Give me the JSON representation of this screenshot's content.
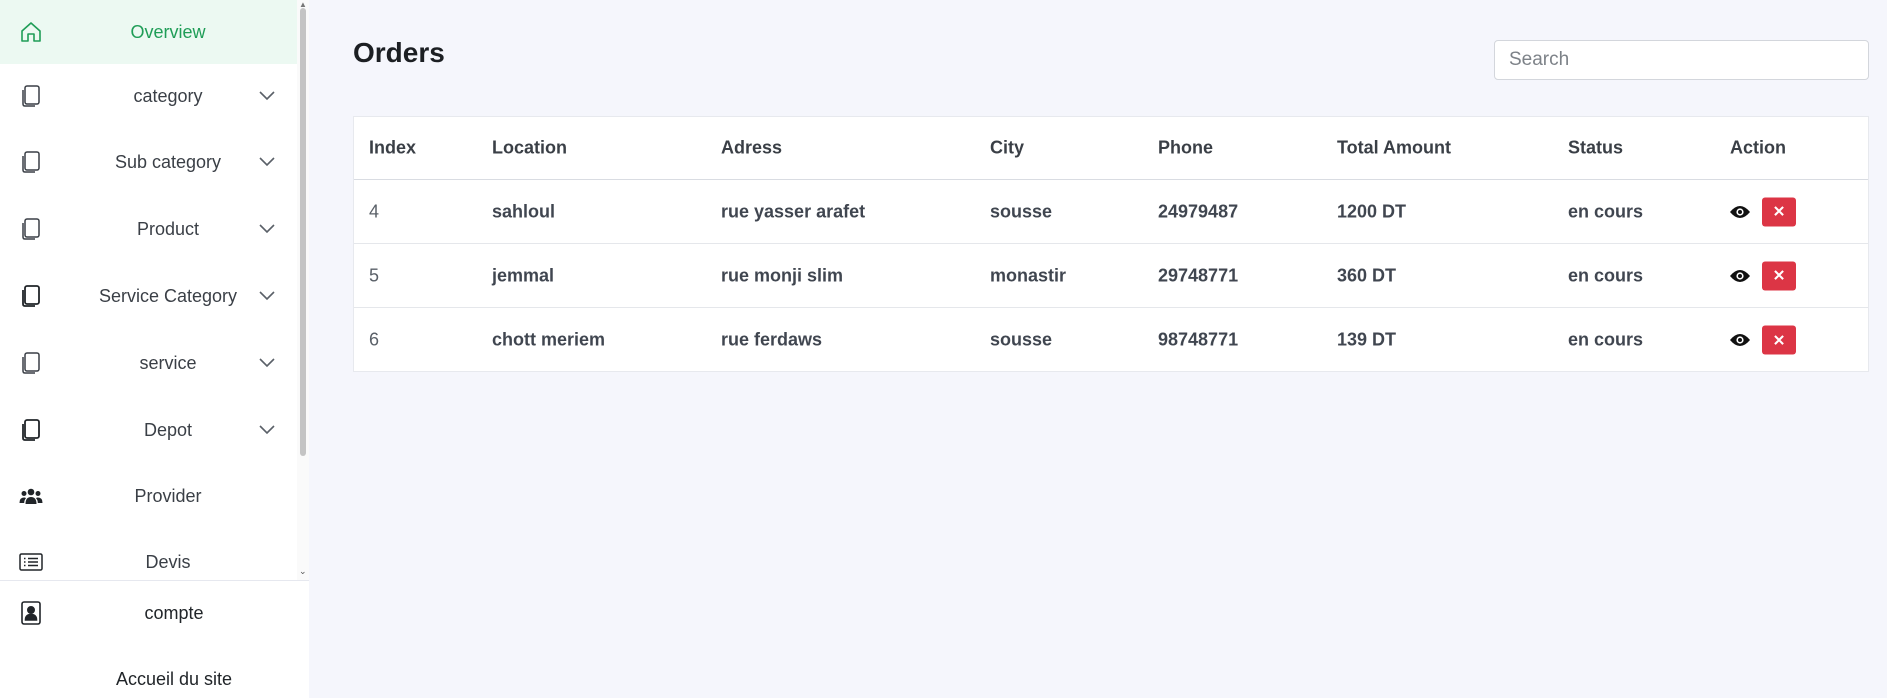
{
  "sidebar": {
    "items": [
      {
        "label": "Overview",
        "icon": "home-icon",
        "active": true,
        "chevron": false
      },
      {
        "label": "category",
        "icon": "copy-icon",
        "chevron": true
      },
      {
        "label": "Sub category",
        "icon": "copy-icon",
        "chevron": true
      },
      {
        "label": "Product",
        "icon": "copy-icon",
        "chevron": true
      },
      {
        "label": "Service Category",
        "icon": "copy-icon",
        "chevron": true
      },
      {
        "label": "service",
        "icon": "copy-icon",
        "chevron": true
      },
      {
        "label": "Depot",
        "icon": "copy-icon",
        "chevron": true
      },
      {
        "label": "Provider",
        "icon": "users-icon",
        "chevron": false
      },
      {
        "label": "Devis",
        "icon": "list-icon",
        "chevron": false
      }
    ],
    "bottom": [
      {
        "label": "compte",
        "icon": "account-icon"
      },
      {
        "label": "Accueil du site",
        "icon": ""
      }
    ]
  },
  "main": {
    "title": "Orders",
    "search": {
      "placeholder": "Search",
      "value": ""
    }
  },
  "table": {
    "headers": [
      "Index",
      "Location",
      "Adress",
      "City",
      "Phone",
      "Total Amount",
      "Status",
      "Action"
    ],
    "rows": [
      [
        "4",
        "sahloul",
        "rue yasser arafet",
        "sousse",
        "24979487",
        "1200 DT",
        "en cours"
      ],
      [
        "5",
        "jemmal",
        "rue monji slim",
        "monastir",
        "29748771",
        "360 DT",
        "en cours"
      ],
      [
        "6",
        "chott meriem",
        "rue ferdaws",
        "sousse",
        "98748771",
        "139 DT",
        "en cours"
      ]
    ],
    "actions": {
      "view_icon": "eye-icon",
      "delete_icon": "close-icon",
      "delete_label": "✕"
    }
  },
  "colors": {
    "accent": "#1f9d57",
    "active_bg": "#ecf9f2",
    "danger": "#dc3545",
    "page_bg": "#f5f6fc"
  }
}
